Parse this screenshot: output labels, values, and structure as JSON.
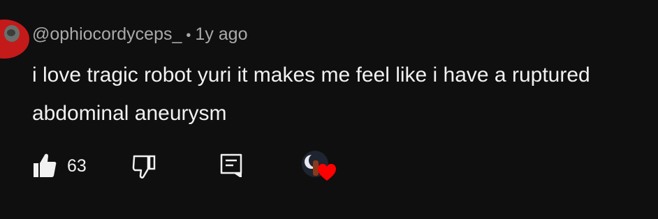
{
  "comment": {
    "author": "@ophiocordyceps_",
    "separator": "•",
    "time_ago": "1y ago",
    "text": "i love tragic robot yuri it makes me feel like i have a ruptured abdominal aneurysm"
  },
  "actions": {
    "like_count": "63",
    "icons": {
      "like": "thumbs-up-icon",
      "dislike": "thumbs-down-icon",
      "reply": "reply-icon",
      "creator_heart": "heart-icon"
    }
  },
  "colors": {
    "background": "#0f0f0f",
    "primary_text": "#f1f1f1",
    "secondary_text": "#aaaaaa",
    "heart": "#ff0000",
    "avatar_accent": "#c41a1a"
  }
}
